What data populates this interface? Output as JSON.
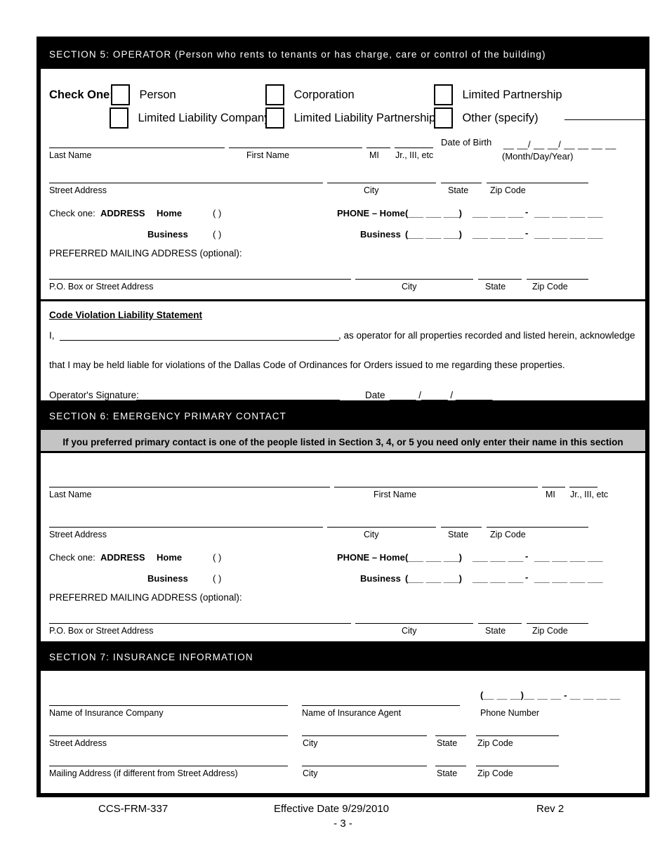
{
  "document": {
    "form_id": "CCS-FRM-337",
    "effective_date": "Effective Date 9/29/2010",
    "revision": "Rev 2",
    "page_marker": "- 3 -"
  },
  "section5": {
    "header": "SECTION 5:  OPERATOR (Person who rents to tenants or has charge, care or control of the building)",
    "check_one_label": "Check One:",
    "options": [
      {
        "label": "Person"
      },
      {
        "label": "Corporation"
      },
      {
        "label": "Limited Partnership"
      },
      {
        "label": "Limited Liability Company"
      },
      {
        "label": "Limited Liability Partnership"
      },
      {
        "label": "Other (specify)"
      }
    ],
    "name_row": {
      "last_name": "Last Name",
      "first_name": "First Name",
      "mi": "MI",
      "suffix": "Jr., III, etc",
      "dob_label": "Date of Birth",
      "dob_pattern": "__ __/ __ __/ __ __ __ __",
      "dob_hint": "(Month/Day/Year)"
    },
    "address_row": {
      "street": "Street Address",
      "city": "City",
      "state": "State",
      "zip": "Zip Code"
    },
    "check_address": {
      "check_one": "Check one:",
      "address_word": "ADDRESS",
      "home": "Home",
      "business": "Business",
      "paren": "(    )"
    },
    "phone": {
      "home_label": "PHONE – Home",
      "business_label": "Business",
      "area_pattern": "(___  ___  ___)",
      "prefix_pattern": "___  ___  ___",
      "dash": "-",
      "line_pattern": "___  ___  ___  ___"
    },
    "preferred_mailing": {
      "title": "PREFERRED MAILING ADDRESS (optional):",
      "pobox": "P.O. Box or Street Address",
      "city": "City",
      "state": "State",
      "zip": "Zip Code"
    }
  },
  "liability": {
    "title": "Code Violation Liability Statement",
    "line1_prefix": "I,",
    "line1_suffix": ", as operator for all properties recorded and listed herein, acknowledge",
    "line2": "that I may be held liable for violations of the Dallas Code of Ordinances for Orders issued to me regarding these properties.",
    "signature_label": "Operator's Signature:",
    "date_label": "Date",
    "date_pattern": "_____ /_____ / _______"
  },
  "section6": {
    "header": "SECTION 6:  EMERGENCY PRIMARY CONTACT",
    "notice": "If you preferred primary contact is one of the people listed in Section 3, 4, or 5 you need only enter their name in this section",
    "name_row": {
      "last_name": "Last Name",
      "first_name": "First Name",
      "mi": "MI",
      "suffix": "Jr., III, etc"
    },
    "address_row": {
      "street": "Street Address",
      "city": "City",
      "state": "State",
      "zip": "Zip Code"
    },
    "check_address": {
      "check_one": "Check one:",
      "address_word": "ADDRESS",
      "home": "Home",
      "business": "Business",
      "paren": "(    )"
    },
    "phone": {
      "home_label": "PHONE – Home",
      "business_label": "Business"
    },
    "preferred_mailing": {
      "title": "PREFERRED MAILING ADDRESS (optional):",
      "pobox": "P.O. Box or Street Address",
      "city": "City",
      "state": "State",
      "zip": "Zip Code"
    }
  },
  "section7": {
    "header": "SECTION 7:  INSURANCE INFORMATION",
    "row1": {
      "company": "Name of Insurance Company",
      "agent": "Name of Insurance Agent",
      "phone": "Phone Number",
      "phone_pattern": "(__ __ __)__ __ __  -  __ __ __ __"
    },
    "row2": {
      "street": "Street Address",
      "city": "City",
      "state": "State",
      "zip": "Zip Code"
    },
    "row3": {
      "mailing": "Mailing Address (if different from Street Address)",
      "city": "City",
      "state": "State",
      "zip": "Zip Code"
    }
  }
}
